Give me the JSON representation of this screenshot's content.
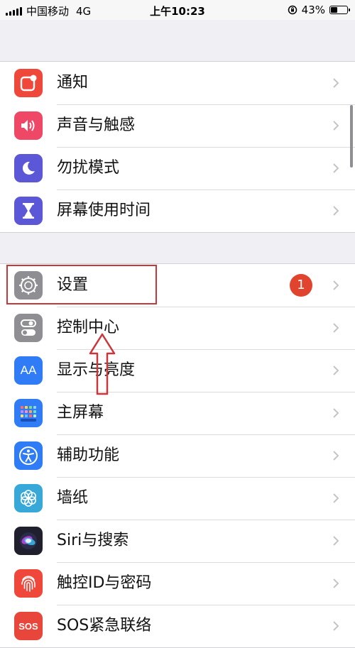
{
  "status_bar": {
    "carrier": "中国移动",
    "network": "4G",
    "time": "上午10:23",
    "battery_percent": "43%",
    "battery_level": 0.43
  },
  "groups": [
    {
      "items": [
        {
          "label": "通知",
          "icon": "notifications-icon",
          "color": "#f0473b"
        },
        {
          "label": "声音与触感",
          "icon": "sounds-icon",
          "color": "#ef4766"
        },
        {
          "label": "勿扰模式",
          "icon": "moon-icon",
          "color": "#5b57d6"
        },
        {
          "label": "屏幕使用时间",
          "icon": "hourglass-icon",
          "color": "#5b57d6"
        }
      ]
    },
    {
      "items": [
        {
          "label": "设置",
          "icon": "gear-icon",
          "color": "#8e8e93",
          "badge": "1"
        },
        {
          "label": "控制中心",
          "icon": "toggles-icon",
          "color": "#8e8e93"
        },
        {
          "label": "显示与亮度",
          "icon": "display-aa-icon",
          "color": "#2f7cf6"
        },
        {
          "label": "主屏幕",
          "icon": "home-screen-icon",
          "color": "#2f7cf6"
        },
        {
          "label": "辅助功能",
          "icon": "accessibility-icon",
          "color": "#2f7cf6"
        },
        {
          "label": "墙纸",
          "icon": "wallpaper-icon",
          "color": "#38a8d9"
        },
        {
          "label": "Siri与搜索",
          "icon": "siri-icon",
          "color": "#1f1f2e"
        },
        {
          "label": "触控ID与密码",
          "icon": "fingerprint-icon",
          "color": "#f0473b"
        },
        {
          "label": "SOS紧急联络",
          "icon": "sos-icon",
          "color": "#e8453b",
          "icon_text": "SOS"
        }
      ]
    }
  ],
  "icon_text": {
    "display": "AA"
  }
}
